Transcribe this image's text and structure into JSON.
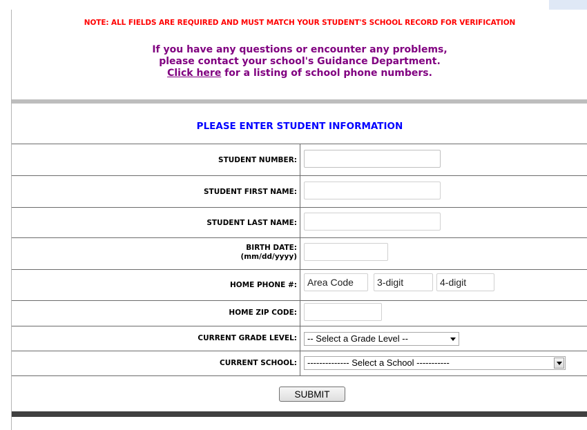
{
  "notice": {
    "required_fields": "NOTE: ALL FIELDS ARE REQUIRED AND MUST MATCH YOUR STUDENT'S SCHOOL RECORD FOR VERIFICATION",
    "help_line1": "If you have any questions or encounter any problems,",
    "help_line2": "please contact your school's Guidance Department.",
    "link_text": "Click here",
    "link_suffix": " for a listing of school phone numbers."
  },
  "form": {
    "heading": "PLEASE ENTER STUDENT INFORMATION",
    "student_number": {
      "label": "STUDENT NUMBER:",
      "value": ""
    },
    "first_name": {
      "label": "STUDENT FIRST NAME:",
      "value": ""
    },
    "last_name": {
      "label": "STUDENT LAST NAME:",
      "value": ""
    },
    "birth_date": {
      "label": "BIRTH DATE:",
      "format": "(mm/dd/yyyy)",
      "value": ""
    },
    "home_phone": {
      "label": "HOME PHONE #:",
      "area_placeholder": "Area Code",
      "prefix_placeholder": "3-digit",
      "line_placeholder": "4-digit"
    },
    "zip": {
      "label": "HOME ZIP CODE:",
      "value": ""
    },
    "grade": {
      "label": "CURRENT GRADE LEVEL:",
      "selected": "-- Select a Grade Level --"
    },
    "school": {
      "label": "CURRENT SCHOOL:",
      "selected": "-------------- Select a School -----------"
    },
    "submit_label": "SUBMIT"
  },
  "colors": {
    "notice_red": "#ff0000",
    "help_purple": "#800080",
    "heading_blue": "#0000ff",
    "separator_gray": "#bdbdbd",
    "separator_dark": "#404040"
  }
}
